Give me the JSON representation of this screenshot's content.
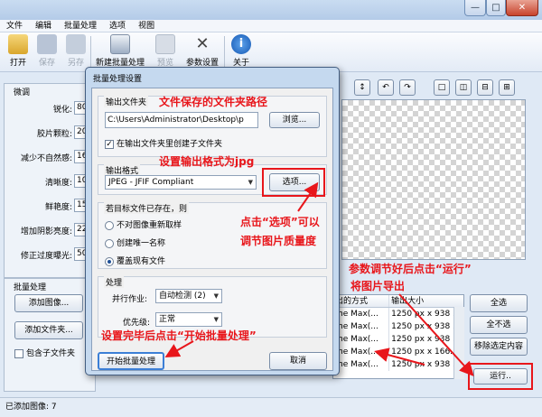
{
  "menu": [
    "文件",
    "编辑",
    "批量处理",
    "选项",
    "视图"
  ],
  "toolbar": {
    "open": "打开",
    "save": "保存",
    "saveas": "另存",
    "batch": "新建批量处理",
    "preview": "预览",
    "params": "参数设置",
    "about": "关于"
  },
  "tune": {
    "title": "微调",
    "fields": [
      {
        "label": "锐化:",
        "value": "80"
      },
      {
        "label": "胶片颗粒:",
        "value": "20"
      },
      {
        "label": "减少不自然感:",
        "value": "16"
      },
      {
        "label": "清晰度:",
        "value": "10"
      },
      {
        "label": "鲜艳度:",
        "value": "15"
      },
      {
        "label": "增加阴影亮度:",
        "value": "22"
      },
      {
        "label": "修正过度曝光:",
        "value": "50"
      }
    ]
  },
  "batch_panel": {
    "title": "批量处理",
    "add_images": "添加图像...",
    "add_folder": "添加文件夹...",
    "include_sub": "包含子文件夹"
  },
  "right_buttons": {
    "select_all": "全选",
    "select_none": "全不选",
    "remove_selected": "移除选定内容",
    "run": "运行.."
  },
  "table": {
    "headers": [
      "出的方式",
      "输出大小"
    ],
    "rows": [
      [
        "me Max(...",
        "1250 px x 938 ."
      ],
      [
        "me Max(...",
        "1250 px x 938 ."
      ],
      [
        "me Max(...",
        "1250 px x 938 ."
      ],
      [
        "me Max(...",
        "1250 px x 166..."
      ],
      [
        "me Max(...",
        "1250 px x 938 ."
      ]
    ]
  },
  "status": "已添加图像: 7",
  "dialog": {
    "title": "批量处理设置",
    "output_folder_label": "输出文件夹",
    "output_path": "C:\\Users\\Administrator\\Desktop\\p",
    "browse": "浏览...",
    "create_subfolder": "在输出文件夹里创建子文件夹",
    "output_format_label": "输出格式",
    "format_value": "JPEG - JFIF Compliant",
    "options": "选项...",
    "exists_label": "若目标文件已存在，则",
    "radio_options": [
      "不对图像重新取样",
      "创建唯一名称",
      "覆盖现有文件"
    ],
    "processing_label": "处理",
    "parallel_label": "并行作业:",
    "parallel_value": "自动检测 (2)",
    "priority_label": "优先级:",
    "priority_value": "正常",
    "start": "开始批量处理",
    "cancel": "取消"
  },
  "annotations": {
    "a1": "文件保存的文件夹路径",
    "a2": "设置输出格式为jpg",
    "a3": "点击“选项”可以",
    "a3b": "调节图片质量度",
    "a4": "参数调节好后点击“运行”",
    "a4b": "将图片导出",
    "a5": "设置完毕后点击“开始批量处理”"
  },
  "colors": {
    "annotation": "#e8161b",
    "accent": "#1e4f96"
  }
}
